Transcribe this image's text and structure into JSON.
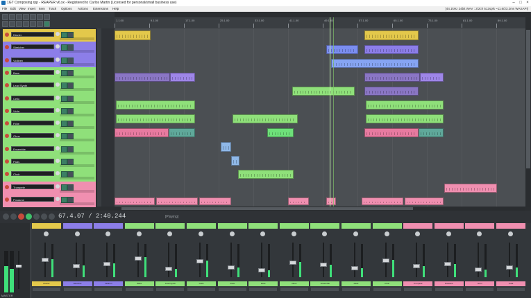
{
  "window": {
    "title": "1GT Composing.rpp - REAPER v6.xx - Registered to Carlos Martin (Licensed for personal/small business use)",
    "menu": [
      "File",
      "Edit",
      "View",
      "Insert",
      "Item",
      "Track",
      "Options",
      "Actions",
      "Extensions",
      "Help"
    ],
    "status_right": "[44.1kHz 24bit WAV : 2/2ch 512spls ~11.6/23.2ms WASAPI]"
  },
  "timeline": {
    "ticks": [
      "1.1.00",
      "9.1.00",
      "17.1.00",
      "25.1.00",
      "33.1.00",
      "41.1.00",
      "49.1.00",
      "57.1.00",
      "65.1.00",
      "73.1.00",
      "81.1.00",
      "89.1.00"
    ]
  },
  "tracks": [
    {
      "name": "Klavier",
      "color": "#e3c84b"
    },
    {
      "name": "Streicher",
      "color": "#8c7ee8"
    },
    {
      "name": "Violinen",
      "color": "#8c7ee8"
    },
    {
      "name": "Bass",
      "color": "#8fe07a"
    },
    {
      "name": "Lead Synth",
      "color": "#8fe07a"
    },
    {
      "name": "Cello",
      "color": "#8fe07a"
    },
    {
      "name": "Viola",
      "color": "#8fe07a"
    },
    {
      "name": "Flöte",
      "color": "#8fe07a"
    },
    {
      "name": "Oboe",
      "color": "#8fe07a"
    },
    {
      "name": "Ensemble",
      "color": "#8fe07a"
    },
    {
      "name": "Pads",
      "color": "#8fe07a"
    },
    {
      "name": "Choir",
      "color": "#8fe07a"
    },
    {
      "name": "Trompete",
      "color": "#f08fb0"
    },
    {
      "name": "Posaune",
      "color": "#f08fb0"
    }
  ],
  "transport": {
    "timecode": "67.4.07 / 2:40.244",
    "state": "[Playing]"
  },
  "mixer": {
    "master_label": "MASTER",
    "strips": [
      {
        "name": "Klavier",
        "color": "#e3c84b",
        "level": 0.55
      },
      {
        "name": "Streicher",
        "color": "#8c7ee8",
        "level": 0.35
      },
      {
        "name": "Violinen",
        "color": "#8c7ee8",
        "level": 0.42
      },
      {
        "name": "Bass",
        "color": "#8fe07a",
        "level": 0.6
      },
      {
        "name": "Lead Synth",
        "color": "#8fe07a",
        "level": 0.25
      },
      {
        "name": "Cello",
        "color": "#8fe07a",
        "level": 0.5
      },
      {
        "name": "Viola",
        "color": "#8fe07a",
        "level": 0.3
      },
      {
        "name": "Flöte",
        "color": "#8fe07a",
        "level": 0.2
      },
      {
        "name": "Oboe",
        "color": "#8fe07a",
        "level": 0.45
      },
      {
        "name": "Ensemble",
        "color": "#8fe07a",
        "level": 0.38
      },
      {
        "name": "Pads",
        "color": "#8fe07a",
        "level": 0.28
      },
      {
        "name": "Choir",
        "color": "#8fe07a",
        "level": 0.52
      },
      {
        "name": "Trompete",
        "color": "#f08fb0",
        "level": 0.33
      },
      {
        "name": "Posaune",
        "color": "#f08fb0",
        "level": 0.4
      },
      {
        "name": "Horn",
        "color": "#f08fb0",
        "level": 0.22
      },
      {
        "name": "Tuba",
        "color": "#f08fb0",
        "level": 0.3
      }
    ]
  }
}
